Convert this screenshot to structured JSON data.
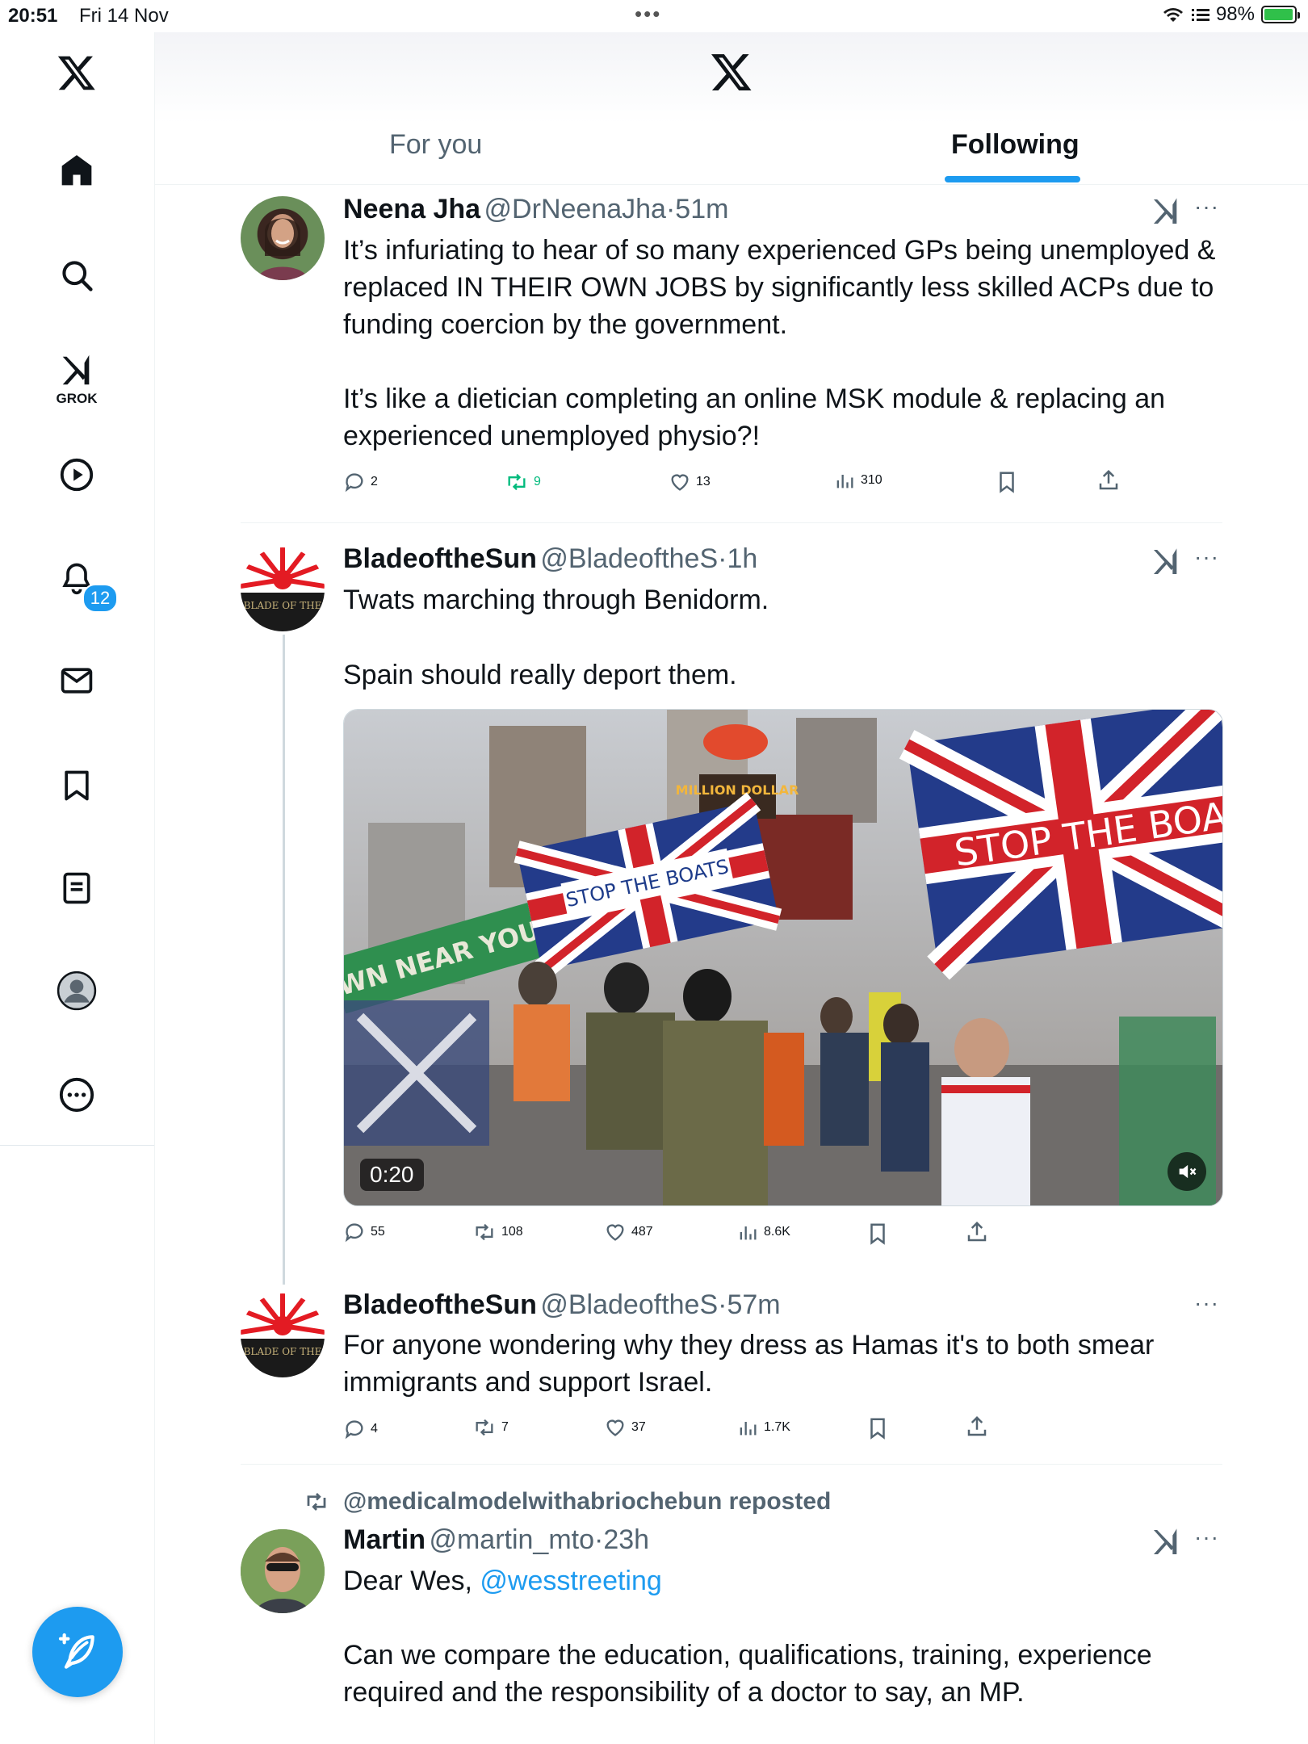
{
  "status_bar": {
    "time": "20:51",
    "date": "Fri 14 Nov",
    "battery": "98%",
    "battery_level": 0.98
  },
  "sidebar": {
    "grok_label": "GROK",
    "notifications_badge": "12",
    "items": [
      "x-logo",
      "home-icon",
      "search-icon",
      "grok-icon",
      "video-icon",
      "bell-icon",
      "mail-icon",
      "bookmark-icon",
      "lists-icon",
      "profile-icon",
      "more-icon"
    ]
  },
  "header": {
    "tabs": [
      {
        "label": "For you"
      },
      {
        "label": "Following",
        "active": true
      }
    ]
  },
  "posts": [
    {
      "name": "Neena Jha",
      "handle": "@DrNeenaJha",
      "time": "51m",
      "text1": "It’s infuriating to hear of so many experienced GPs being unemployed & replaced IN THEIR OWN JOBS by significantly less skilled ACPs due to funding coercion by the government.",
      "text2": "It’s like a dietician completing an online MSK module & replacing an experienced unemployed physio?!",
      "replies": "2",
      "reposts": "9",
      "likes": "13",
      "views": "310"
    },
    {
      "name": "BladeoftheSun",
      "handle": "@BladeoftheS",
      "time": "1h",
      "text1": "Twats marching through Benidorm.",
      "text2": "Spain should really deport them.",
      "media": {
        "duration": "0:20",
        "banner_left": "WN NEAR YOU",
        "banner_mid": "STOP THE BOATS",
        "banner_right": "STOP THE BOA",
        "sign": "MILLION DOLLAR"
      },
      "replies": "55",
      "reposts": "108",
      "likes": "487",
      "views": "8.6K"
    },
    {
      "name": "BladeoftheSun",
      "handle": "@BladeoftheS",
      "time": "57m",
      "text1": "For anyone wondering why they dress as Hamas it's to both smear immigrants and support Israel.",
      "replies": "4",
      "reposts": "7",
      "likes": "37",
      "views": "1.7K"
    },
    {
      "repost_label": "@medicalmodelwithabriochebun reposted",
      "name": "Martin",
      "handle": "@martin_mto",
      "time": "23h",
      "text1_prefix": "Dear Wes, ",
      "text1_link": "@wesstreeting",
      "text2": "Can we compare the education, qualifications, training, experience required and the responsibility of a doctor to say, an MP."
    }
  ],
  "avatar_text": "BLADE OF THE"
}
